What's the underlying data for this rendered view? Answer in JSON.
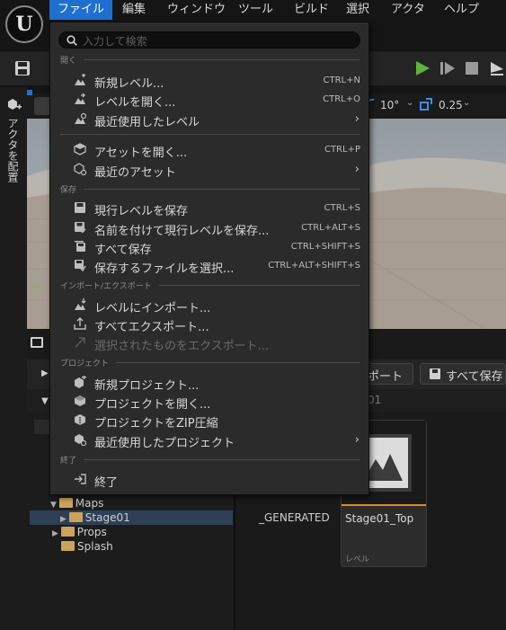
{
  "menubar": {
    "items": [
      {
        "label": "ファイル",
        "active": true
      },
      {
        "label": "編集"
      },
      {
        "label": "ウィンドウ"
      },
      {
        "label": "ツール"
      },
      {
        "label": "ビルド"
      },
      {
        "label": "選択"
      },
      {
        "label": "アクタ"
      },
      {
        "label": "ヘルプ"
      }
    ]
  },
  "left_panel": {
    "place_actors_label": "アクタを配置"
  },
  "viewport": {
    "rotation_snap": "10°",
    "scale_snap": "0.25",
    "axis_label": "Y"
  },
  "file_menu": {
    "search_placeholder": "入力して検索",
    "sections": {
      "open": "開く",
      "save": "保存",
      "import_export": "インポート/エクスポート",
      "project": "プロジェクト",
      "exit": "終了"
    },
    "items": {
      "new_level": {
        "label": "新規レベル...",
        "shortcut": "CTRL+N",
        "icon": "new-level-icon"
      },
      "open_level": {
        "label": "レベルを開く...",
        "shortcut": "CTRL+O",
        "icon": "open-level-icon"
      },
      "recent_levels": {
        "label": "最近使用したレベル",
        "icon": "recent-level-icon"
      },
      "open_asset": {
        "label": "アセットを開く...",
        "shortcut": "CTRL+P",
        "icon": "open-asset-icon"
      },
      "recent_assets": {
        "label": "最近のアセット",
        "icon": "recent-asset-icon"
      },
      "save_current": {
        "label": "現行レベルを保存",
        "shortcut": "CTRL+S",
        "icon": "save-icon"
      },
      "save_as": {
        "label": "名前を付けて現行レベルを保存...",
        "shortcut": "CTRL+ALT+S",
        "icon": "save-as-icon"
      },
      "save_all": {
        "label": "すべて保存",
        "shortcut": "CTRL+SHIFT+S",
        "icon": "save-all-icon"
      },
      "choose_files": {
        "label": "保存するファイルを選択...",
        "shortcut": "CTRL+ALT+SHIFT+S",
        "icon": "choose-files-icon"
      },
      "import_level": {
        "label": "レベルにインポート...",
        "icon": "import-icon"
      },
      "export_all": {
        "label": "すべてエクスポート...",
        "icon": "export-icon"
      },
      "export_selected": {
        "label": "選択されたものをエクスポート...",
        "icon": "export-selected-icon",
        "disabled": true
      },
      "new_project": {
        "label": "新規プロジェクト...",
        "icon": "new-project-icon"
      },
      "open_project": {
        "label": "プロジェクトを開く...",
        "icon": "open-project-icon"
      },
      "zip_project": {
        "label": "プロジェクトをZIP圧縮",
        "icon": "zip-icon"
      },
      "recent_projects": {
        "label": "最近使用したプロジェクト",
        "icon": "recent-project-icon"
      },
      "exit": {
        "label": "終了",
        "icon": "exit-icon"
      }
    }
  },
  "content_browser": {
    "import_label": "ポート",
    "save_all_label": "すべて保存",
    "path_fragment": "01",
    "tree": [
      {
        "label": "Maps",
        "expanded": true
      },
      {
        "label": "Stage01",
        "selected": true
      },
      {
        "label": "Props"
      },
      {
        "label": "Splash"
      }
    ],
    "generated_label": "_GENERATED",
    "asset_tile": {
      "name": "Stage01_Top",
      "type": "レベル"
    }
  },
  "colors": {
    "accent": "#1f6fd1",
    "folder": "#c9a45a",
    "play": "#5fb23d"
  }
}
